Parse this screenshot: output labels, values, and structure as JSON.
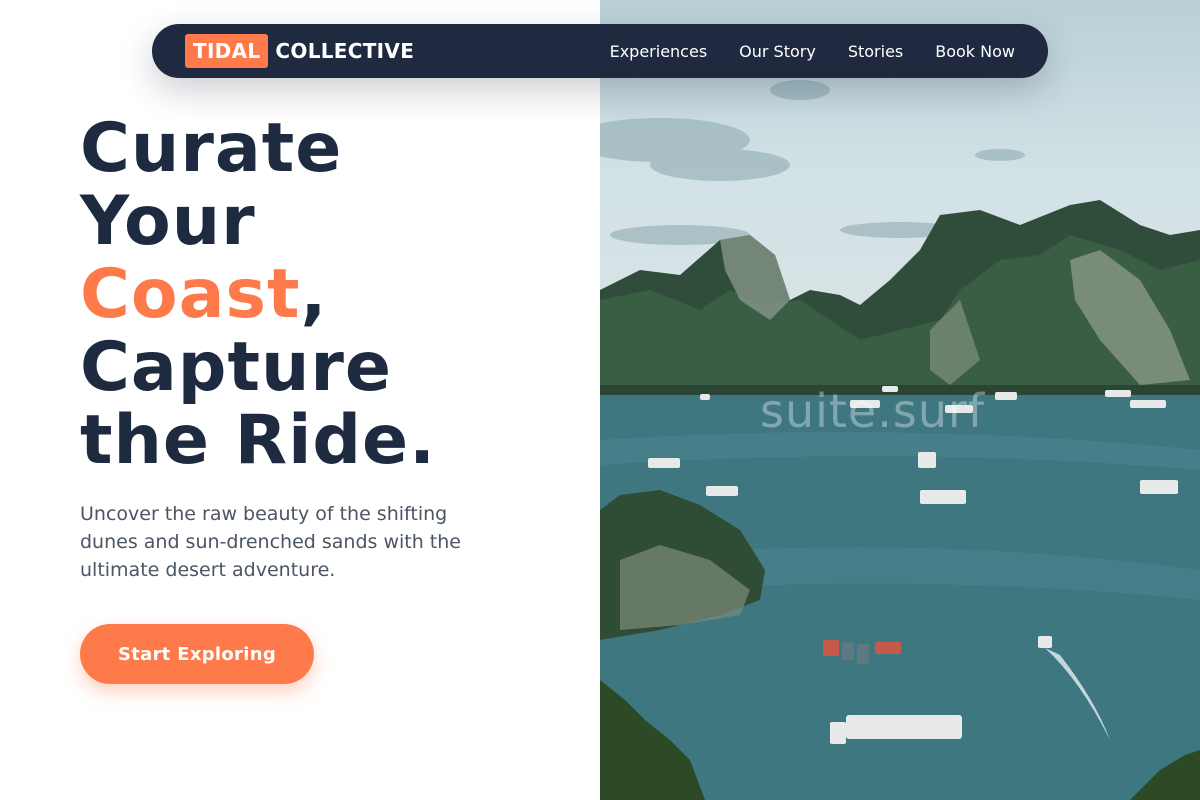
{
  "nav": {
    "brand_tag": "TIDAL",
    "brand_rest": "COLLECTIVE",
    "links": [
      "Experiences",
      "Our Story",
      "Stories",
      "Book Now"
    ]
  },
  "hero": {
    "title_line1": "Curate",
    "title_line2": "Your",
    "title_accent": "Coast",
    "title_comma": ",",
    "title_line4": "Capture",
    "title_line5": "the Ride.",
    "subtitle": "Uncover the raw beauty of the shifting dunes and sun-drenched sands with the ultimate desert adventure.",
    "cta_label": "Start Exploring"
  },
  "photo": {
    "watermark": "suite.surf",
    "description": "bay-with-karst-islands-and-boats"
  },
  "colors": {
    "accent": "#ff7a4a",
    "navy": "#1f2a40",
    "text_muted": "#4b5563"
  }
}
